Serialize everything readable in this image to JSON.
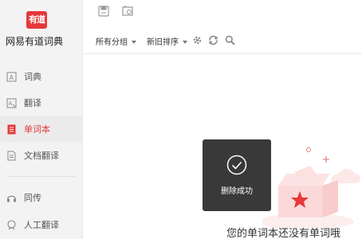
{
  "app": {
    "logo_text": "有道",
    "name": "网易有道词典"
  },
  "sidebar": {
    "items": [
      {
        "label": "词典",
        "icon": "dictionary-icon"
      },
      {
        "label": "翻译",
        "icon": "translate-icon"
      },
      {
        "label": "单词本",
        "icon": "wordbook-icon",
        "active": true
      },
      {
        "label": "文档翻译",
        "icon": "document-translate-icon"
      },
      {
        "label": "同传",
        "icon": "simultaneous-interpretation-icon"
      },
      {
        "label": "人工翻译",
        "icon": "human-translation-icon"
      }
    ]
  },
  "toolbar": {
    "icons": [
      "save-icon",
      "image-icon"
    ]
  },
  "filters": {
    "group_label": "所有分组",
    "sort_label": "新旧排序",
    "icons": [
      "settings-gear-icon",
      "refresh-icon",
      "search-icon"
    ]
  },
  "main": {
    "empty_message": "您的单词本还没有单词哦"
  },
  "toast": {
    "message": "删除成功",
    "icon": "check-circle-icon"
  },
  "colors": {
    "accent": "#e6393a",
    "sidebar_bg": "#f3f3f3",
    "toast_bg": "#282828"
  }
}
